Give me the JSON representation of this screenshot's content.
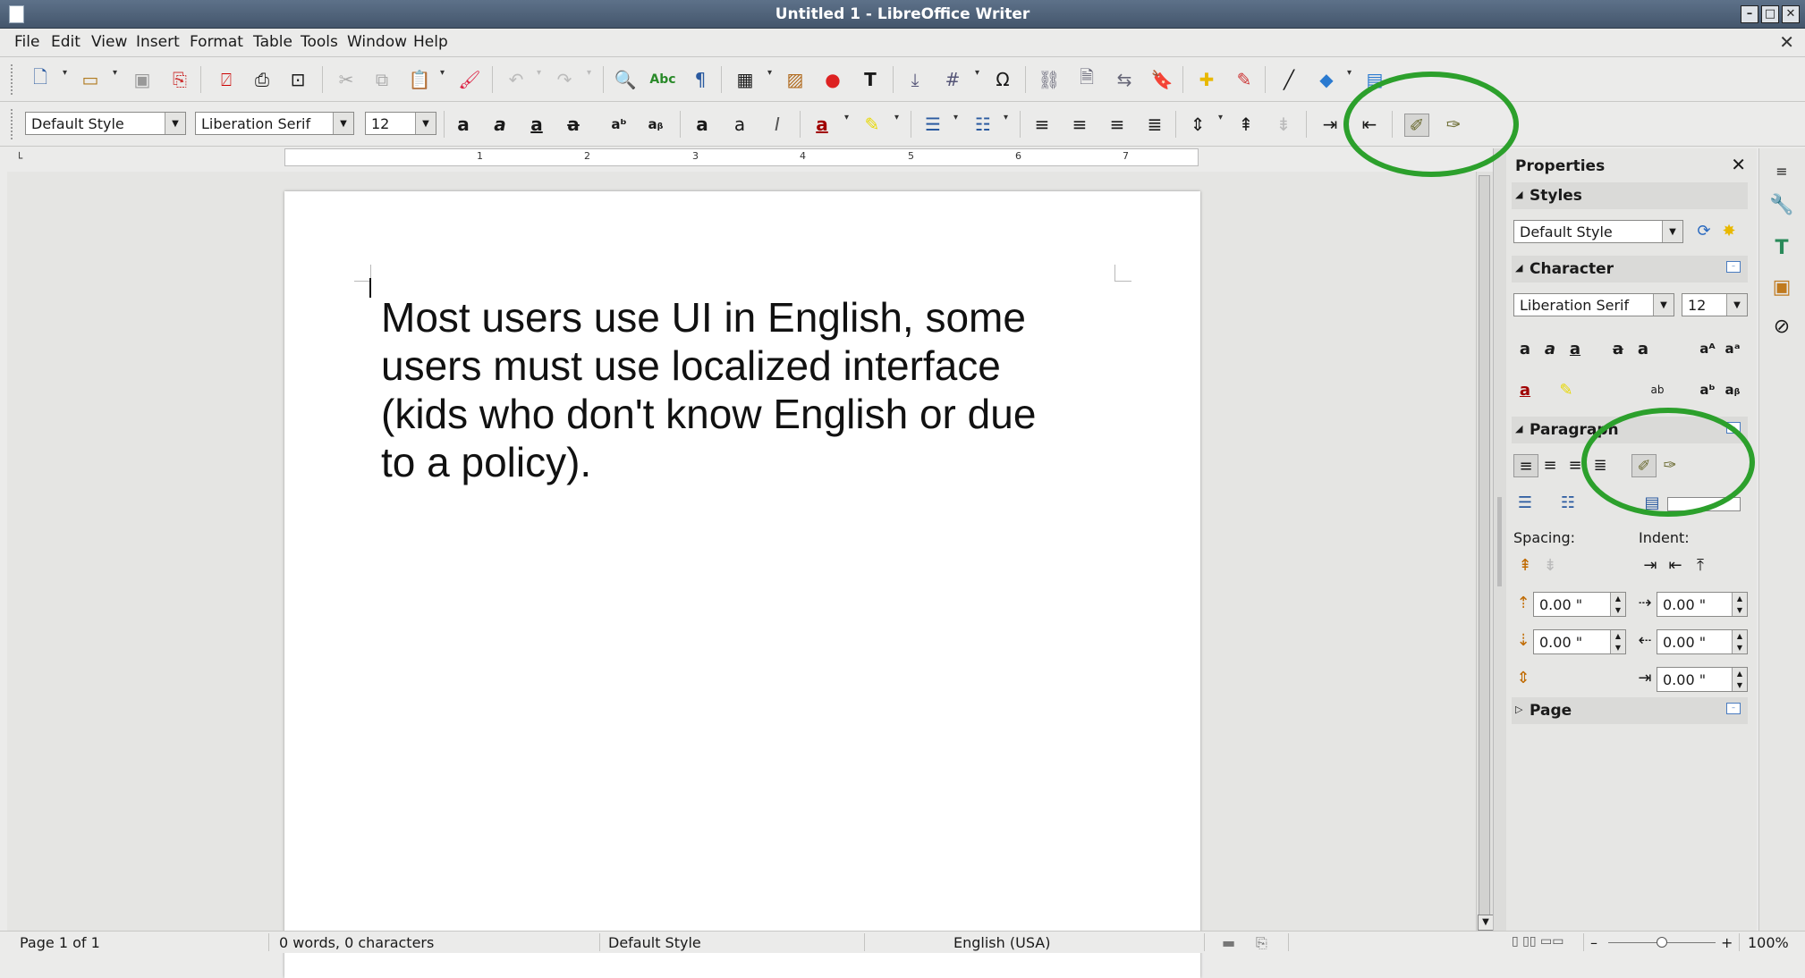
{
  "window": {
    "title": "Untitled 1 - LibreOffice Writer",
    "controls": [
      "minimize-icon",
      "maximize-icon",
      "close-icon"
    ]
  },
  "menu": [
    "File",
    "Edit",
    "View",
    "Insert",
    "Format",
    "Table",
    "Tools",
    "Window",
    "Help"
  ],
  "formatting": {
    "paragraph_style": "Default Style",
    "font_name": "Liberation Serif",
    "font_size": "12"
  },
  "document": {
    "lines": [
      "Most users use UI in English, some",
      "users must use localized interface",
      "(kids who don't know English or due",
      "to a policy)."
    ]
  },
  "ruler_numbers": [
    "1",
    "2",
    "3",
    "4",
    "5",
    "6",
    "7"
  ],
  "sidebar": {
    "title": "Properties",
    "sections": {
      "styles": "Styles",
      "character": "Character",
      "paragraph": "Paragraph",
      "page": "Page"
    },
    "style_value": "Default Style",
    "font_value": "Liberation Serif",
    "size_value": "12",
    "spacing_label": "Spacing:",
    "indent_label": "Indent:",
    "spin_values": [
      "0.00 \"",
      "0.00 \"",
      "0.00 \"",
      "0.00 \"",
      "0.00 \""
    ]
  },
  "status": {
    "page": "Page 1 of 1",
    "words": "0 words, 0 characters",
    "style": "Default Style",
    "language": "English (USA)",
    "zoom": "100%"
  },
  "annotation_color": "#2ca02c"
}
